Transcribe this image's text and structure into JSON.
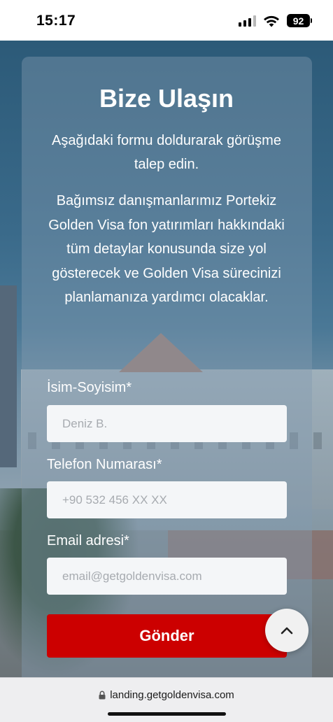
{
  "status_bar": {
    "time": "15:17",
    "battery": "92",
    "icons": [
      "signal-icon",
      "wifi-icon",
      "battery-icon"
    ]
  },
  "form": {
    "title": "Bize Ulaşın",
    "intro": "Aşağıdaki formu doldurarak görüşme talep edin.",
    "description": "Bağımsız danışmanlarımız Portekiz Golden Visa fon yatırımları hakkındaki tüm detaylar konusunda size yol gösterecek ve Golden Visa sürecinizi planlamanıza yardımcı olacaklar.",
    "fields": [
      {
        "label": "İsim-Soyisim*",
        "placeholder": "Deniz B.",
        "value": ""
      },
      {
        "label": "Telefon Numarası*",
        "placeholder": "+90 532 456 XX XX",
        "value": ""
      },
      {
        "label": "Email adresi*",
        "placeholder": "email@getgoldenvisa.com",
        "value": ""
      }
    ],
    "submit_label": "Gönder"
  },
  "scroll_top": {
    "icon": "chevron-up-icon"
  },
  "browser": {
    "url": "landing.getgoldenvisa.com",
    "lock_icon": "lock-icon"
  },
  "colors": {
    "accent": "#cc0000",
    "card": "#849ab0",
    "input_bg": "#f4f6f8"
  }
}
